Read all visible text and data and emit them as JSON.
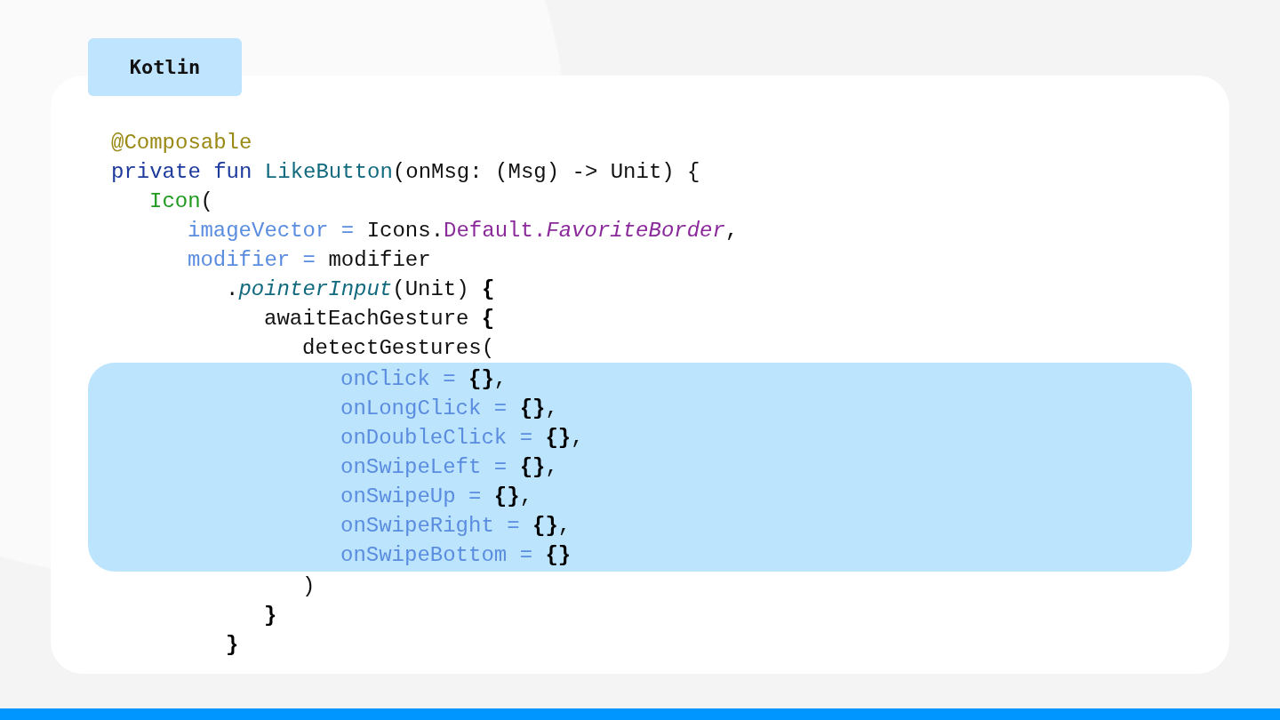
{
  "tab": {
    "label": "Kotlin"
  },
  "code": {
    "lines": [
      {
        "highlighted": false,
        "tokens": [
          {
            "kind": "annotation",
            "text": "@Composable"
          }
        ]
      },
      {
        "highlighted": false,
        "tokens": [
          {
            "kind": "keyword",
            "text": "private fun "
          },
          {
            "kind": "declaration",
            "text": "LikeButton"
          },
          {
            "kind": "plain",
            "text": "(onMsg: (Msg) -> Unit) {"
          }
        ],
        "children": [
          {
            "highlighted": false,
            "tokens": [
              {
                "kind": "call",
                "text": "Icon"
              },
              {
                "kind": "plain",
                "text": "("
              }
            ],
            "children": [
              {
                "highlighted": false,
                "tokens": [
                  {
                    "kind": "named-arg",
                    "text": "imageVector = "
                  },
                  {
                    "kind": "plain",
                    "text": "Icons."
                  },
                  {
                    "kind": "property",
                    "text": "Default."
                  },
                  {
                    "kind": "italic-property",
                    "text": "FavoriteBorder"
                  },
                  {
                    "kind": "plain",
                    "text": ","
                  }
                ]
              },
              {
                "highlighted": false,
                "tokens": [
                  {
                    "kind": "named-arg",
                    "text": "modifier = "
                  },
                  {
                    "kind": "plain",
                    "text": "modifier"
                  }
                ],
                "children": [
                  {
                    "highlighted": false,
                    "tokens": [
                      {
                        "kind": "plain",
                        "text": "."
                      },
                      {
                        "kind": "italic-method",
                        "text": "pointerInput"
                      },
                      {
                        "kind": "plain",
                        "text": "(Unit) "
                      },
                      {
                        "kind": "brace",
                        "text": "{"
                      }
                    ],
                    "children": [
                      {
                        "highlighted": false,
                        "tokens": [
                          {
                            "kind": "plain",
                            "text": "awaitEachGesture "
                          },
                          {
                            "kind": "brace",
                            "text": "{"
                          }
                        ],
                        "children": [
                          {
                            "highlighted": false,
                            "tokens": [
                              {
                                "kind": "plain",
                                "text": "detectGestures("
                              }
                            ],
                            "children": [
                              {
                                "highlighted": true,
                                "tokens": [
                                  {
                                    "kind": "named-arg",
                                    "text": "onClick = "
                                  },
                                  {
                                    "kind": "brace",
                                    "text": "{}"
                                  },
                                  {
                                    "kind": "plain",
                                    "text": ","
                                  }
                                ]
                              },
                              {
                                "highlighted": true,
                                "tokens": [
                                  {
                                    "kind": "named-arg",
                                    "text": "onLongClick = "
                                  },
                                  {
                                    "kind": "brace",
                                    "text": "{}"
                                  },
                                  {
                                    "kind": "plain",
                                    "text": ","
                                  }
                                ]
                              },
                              {
                                "highlighted": true,
                                "tokens": [
                                  {
                                    "kind": "named-arg",
                                    "text": "onDoubleClick = "
                                  },
                                  {
                                    "kind": "brace",
                                    "text": "{}"
                                  },
                                  {
                                    "kind": "plain",
                                    "text": ","
                                  }
                                ]
                              },
                              {
                                "highlighted": true,
                                "tokens": [
                                  {
                                    "kind": "named-arg",
                                    "text": "onSwipeLeft = "
                                  },
                                  {
                                    "kind": "brace",
                                    "text": "{}"
                                  },
                                  {
                                    "kind": "plain",
                                    "text": ","
                                  }
                                ]
                              },
                              {
                                "highlighted": true,
                                "tokens": [
                                  {
                                    "kind": "named-arg",
                                    "text": "onSwipeUp = "
                                  },
                                  {
                                    "kind": "brace",
                                    "text": "{}"
                                  },
                                  {
                                    "kind": "plain",
                                    "text": ","
                                  }
                                ]
                              },
                              {
                                "highlighted": true,
                                "tokens": [
                                  {
                                    "kind": "named-arg",
                                    "text": "onSwipeRight = "
                                  },
                                  {
                                    "kind": "brace",
                                    "text": "{}"
                                  },
                                  {
                                    "kind": "plain",
                                    "text": ","
                                  }
                                ]
                              },
                              {
                                "highlighted": true,
                                "tokens": [
                                  {
                                    "kind": "named-arg",
                                    "text": "onSwipeBottom = "
                                  },
                                  {
                                    "kind": "brace",
                                    "text": "{}"
                                  }
                                ]
                              }
                            ]
                          },
                          {
                            "highlighted": false,
                            "tokens": [
                              {
                                "kind": "plain",
                                "text": ")"
                              }
                            ]
                          }
                        ]
                      },
                      {
                        "highlighted": false,
                        "tokens": [
                          {
                            "kind": "brace",
                            "text": "}"
                          }
                        ]
                      }
                    ]
                  },
                  {
                    "highlighted": false,
                    "tokens": [
                      {
                        "kind": "brace",
                        "text": "}"
                      }
                    ]
                  }
                ]
              }
            ]
          }
        ]
      }
    ]
  }
}
